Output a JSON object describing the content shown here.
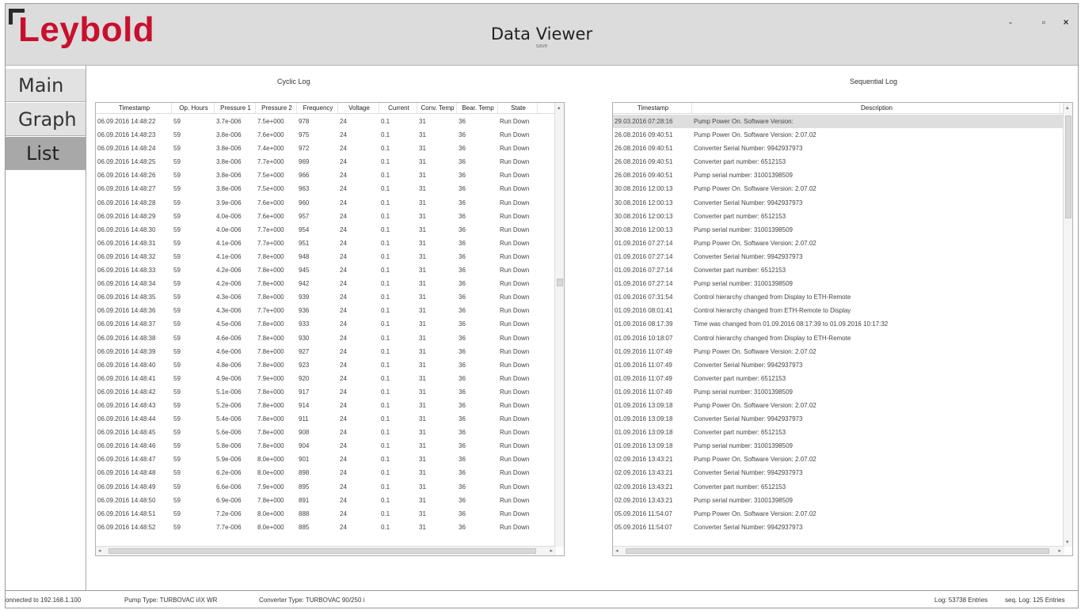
{
  "window": {
    "title": "Data Viewer",
    "subtitle": "save",
    "logo_text": "Leybold",
    "controls": {
      "minimize": "-",
      "maximize": "▫",
      "close": "×"
    }
  },
  "nav": {
    "items": [
      {
        "label": "Main"
      },
      {
        "label": "Graph"
      },
      {
        "label": "List"
      }
    ],
    "active": "List"
  },
  "cyclic_log": {
    "title": "Cyclic Log",
    "columns": [
      "Timestamp",
      "Op. Hours",
      "Pressure 1",
      "Pressure 2",
      "Frequency",
      "Voltage",
      "Current",
      "Conv. Temp",
      "Bear. Temp",
      "State"
    ],
    "rows": [
      [
        "06.09.2016 14:48:22",
        "59",
        "3.7e-006",
        "7.5e+000",
        "978",
        "24",
        "0.1",
        "31",
        "36",
        "Run Down"
      ],
      [
        "06.09.2016 14:48:23",
        "59",
        "3.8e-006",
        "7.6e+000",
        "975",
        "24",
        "0.1",
        "31",
        "36",
        "Run Down"
      ],
      [
        "06.09.2016 14:48:24",
        "59",
        "3.8e-006",
        "7.4e+000",
        "972",
        "24",
        "0.1",
        "31",
        "36",
        "Run Down"
      ],
      [
        "06.09.2016 14:48:25",
        "59",
        "3.8e-006",
        "7.7e+000",
        "969",
        "24",
        "0.1",
        "31",
        "36",
        "Run Down"
      ],
      [
        "06.09.2016 14:48:26",
        "59",
        "3.8e-006",
        "7.5e+000",
        "966",
        "24",
        "0.1",
        "31",
        "36",
        "Run Down"
      ],
      [
        "06.09.2016 14:48:27",
        "59",
        "3.8e-006",
        "7.5e+000",
        "963",
        "24",
        "0.1",
        "31",
        "36",
        "Run Down"
      ],
      [
        "06.09.2016 14:48:28",
        "59",
        "3.9e-006",
        "7.6e+000",
        "960",
        "24",
        "0.1",
        "31",
        "36",
        "Run Down"
      ],
      [
        "06.09.2016 14:48:29",
        "59",
        "4.0e-006",
        "7.6e+000",
        "957",
        "24",
        "0.1",
        "31",
        "36",
        "Run Down"
      ],
      [
        "06.09.2016 14:48:30",
        "59",
        "4.0e-006",
        "7.7e+000",
        "954",
        "24",
        "0.1",
        "31",
        "36",
        "Run Down"
      ],
      [
        "06.09.2016 14:48:31",
        "59",
        "4.1e-006",
        "7.7e+000",
        "951",
        "24",
        "0.1",
        "31",
        "36",
        "Run Down"
      ],
      [
        "06.09.2016 14:48:32",
        "59",
        "4.1e-006",
        "7.8e+000",
        "948",
        "24",
        "0.1",
        "31",
        "36",
        "Run Down"
      ],
      [
        "06.09.2016 14:48:33",
        "59",
        "4.2e-006",
        "7.8e+000",
        "945",
        "24",
        "0.1",
        "31",
        "36",
        "Run Down"
      ],
      [
        "06.09.2016 14:48:34",
        "59",
        "4.2e-006",
        "7.8e+000",
        "942",
        "24",
        "0.1",
        "31",
        "36",
        "Run Down"
      ],
      [
        "06.09.2016 14:48:35",
        "59",
        "4.3e-006",
        "7.8e+000",
        "939",
        "24",
        "0.1",
        "31",
        "36",
        "Run Down"
      ],
      [
        "06.09.2016 14:48:36",
        "59",
        "4.3e-006",
        "7.7e+000",
        "936",
        "24",
        "0.1",
        "31",
        "36",
        "Run Down"
      ],
      [
        "06.09.2016 14:48:37",
        "59",
        "4.5e-006",
        "7.8e+000",
        "933",
        "24",
        "0.1",
        "31",
        "36",
        "Run Down"
      ],
      [
        "06.09.2016 14:48:38",
        "59",
        "4.6e-006",
        "7.8e+000",
        "930",
        "24",
        "0.1",
        "31",
        "36",
        "Run Down"
      ],
      [
        "06.09.2016 14:48:39",
        "59",
        "4.6e-006",
        "7.8e+000",
        "927",
        "24",
        "0.1",
        "31",
        "36",
        "Run Down"
      ],
      [
        "06.09.2016 14:48:40",
        "59",
        "4.8e-006",
        "7.8e+000",
        "923",
        "24",
        "0.1",
        "31",
        "36",
        "Run Down"
      ],
      [
        "06.09.2016 14:48:41",
        "59",
        "4.9e-006",
        "7.9e+000",
        "920",
        "24",
        "0.1",
        "31",
        "36",
        "Run Down"
      ],
      [
        "06.09.2016 14:48:42",
        "59",
        "5.1e-006",
        "7.8e+000",
        "917",
        "24",
        "0.1",
        "31",
        "36",
        "Run Down"
      ],
      [
        "06.09.2016 14:48:43",
        "59",
        "5.2e-006",
        "7.8e+000",
        "914",
        "24",
        "0.1",
        "31",
        "36",
        "Run Down"
      ],
      [
        "06.09.2016 14:48:44",
        "59",
        "5.4e-006",
        "7.8e+000",
        "911",
        "24",
        "0.1",
        "31",
        "36",
        "Run Down"
      ],
      [
        "06.09.2016 14:48:45",
        "59",
        "5.6e-006",
        "7.8e+000",
        "908",
        "24",
        "0.1",
        "31",
        "36",
        "Run Down"
      ],
      [
        "06.09.2016 14:48:46",
        "59",
        "5.8e-006",
        "7.8e+000",
        "904",
        "24",
        "0.1",
        "31",
        "36",
        "Run Down"
      ],
      [
        "06.09.2016 14:48:47",
        "59",
        "5.9e-006",
        "8.0e+000",
        "901",
        "24",
        "0.1",
        "31",
        "36",
        "Run Down"
      ],
      [
        "06.09.2016 14:48:48",
        "59",
        "6.2e-006",
        "8.0e+000",
        "898",
        "24",
        "0.1",
        "31",
        "36",
        "Run Down"
      ],
      [
        "06.09.2016 14:48:49",
        "59",
        "6.6e-006",
        "7.9e+000",
        "895",
        "24",
        "0.1",
        "31",
        "36",
        "Run Down"
      ],
      [
        "06.09.2016 14:48:50",
        "59",
        "6.9e-006",
        "7.8e+000",
        "891",
        "24",
        "0.1",
        "31",
        "36",
        "Run Down"
      ],
      [
        "06.09.2016 14:48:51",
        "59",
        "7.2e-006",
        "8.0e+000",
        "888",
        "24",
        "0.1",
        "31",
        "36",
        "Run Down"
      ],
      [
        "06.09.2016 14:48:52",
        "59",
        "7.7e-006",
        "8.0e+000",
        "885",
        "24",
        "0.1",
        "31",
        "36",
        "Run Down"
      ]
    ]
  },
  "sequential_log": {
    "title": "Sequential Log",
    "columns": [
      "Timestamp",
      "Description"
    ],
    "rows": [
      [
        "29.03.2016 07:28:16",
        "Pump Power On. Software Version:"
      ],
      [
        "26.08.2016 09:40:51",
        "Pump Power On. Software Version: 2.07.02"
      ],
      [
        "26.08.2016 09:40:51",
        "Converter Serial Number: 9942937973"
      ],
      [
        "26.08.2016 09:40:51",
        "Converter part number: 6512153"
      ],
      [
        "26.08.2016 09:40:51",
        "Pump serial number: 31001398509"
      ],
      [
        "30.08.2016 12:00:13",
        "Pump Power On. Software Version: 2.07.02"
      ],
      [
        "30.08.2016 12:00:13",
        "Converter Serial Number: 9942937973"
      ],
      [
        "30.08.2016 12:00:13",
        "Converter part number: 6512153"
      ],
      [
        "30.08.2016 12:00:13",
        "Pump serial number: 31001398509"
      ],
      [
        "01.09.2016 07:27:14",
        "Pump Power On. Software Version: 2.07.02"
      ],
      [
        "01.09.2016 07:27:14",
        "Converter Serial Number: 9942937973"
      ],
      [
        "01.09.2016 07:27:14",
        "Converter part number: 6512153"
      ],
      [
        "01.09.2016 07:27:14",
        "Pump serial number: 31001398509"
      ],
      [
        "01.09.2016 07:31:54",
        "Control hierarchy changed from Display to ETH-Remote"
      ],
      [
        "01.09.2016 08:01:41",
        "Control hierarchy changed from ETH-Remote to Display"
      ],
      [
        "01.09.2016 08:17:39",
        "Time was changed from 01.09.2016 08:17:39 to 01.09.2016 10:17:32"
      ],
      [
        "01.09.2016 10:18:07",
        "Control hierarchy changed from Display to ETH-Remote"
      ],
      [
        "01.09.2016 11:07:49",
        "Pump Power On. Software Version: 2.07.02"
      ],
      [
        "01.09.2016 11:07:49",
        "Converter Serial Number: 9942937973"
      ],
      [
        "01.09.2016 11:07:49",
        "Converter part number: 6512153"
      ],
      [
        "01.09.2016 11:07:49",
        "Pump serial number: 31001398509"
      ],
      [
        "01.09.2016 13:09:18",
        "Pump Power On. Software Version: 2.07.02"
      ],
      [
        "01.09.2016 13:09:18",
        "Converter Serial Number: 9942937973"
      ],
      [
        "01.09.2016 13:09:18",
        "Converter part number: 6512153"
      ],
      [
        "01.09.2016 13:09:18",
        "Pump serial number: 31001398509"
      ],
      [
        "02.09.2016 13:43:21",
        "Pump Power On. Software Version: 2.07.02"
      ],
      [
        "02.09.2016 13:43:21",
        "Converter Serial Number: 9942937973"
      ],
      [
        "02.09.2016 13:43:21",
        "Converter part number: 6512153"
      ],
      [
        "02.09.2016 13:43:21",
        "Pump serial number: 31001398509"
      ],
      [
        "05.09.2016 11:54:07",
        "Pump Power On. Software Version: 2.07.02"
      ],
      [
        "05.09.2016 11:54:07",
        "Converter Serial Number: 9942937973"
      ]
    ],
    "selected_row": 0
  },
  "status": {
    "connection": "onnected to 192.168.1.100",
    "pump_type": "Pump Type: TURBOVAC i/iX WR",
    "converter_type": "Converter Type: TURBOVAC 90/250 i",
    "log_entries": "Log: 53738 Entries",
    "seq_log_entries": "seq. Log: 125 Entries"
  },
  "colors": {
    "brand_red": "#c8102e",
    "titlebar_bg": "#dcdcdc",
    "nav_active_bg": "#a8a8a8",
    "nav_bg": "#e2e2e2"
  }
}
